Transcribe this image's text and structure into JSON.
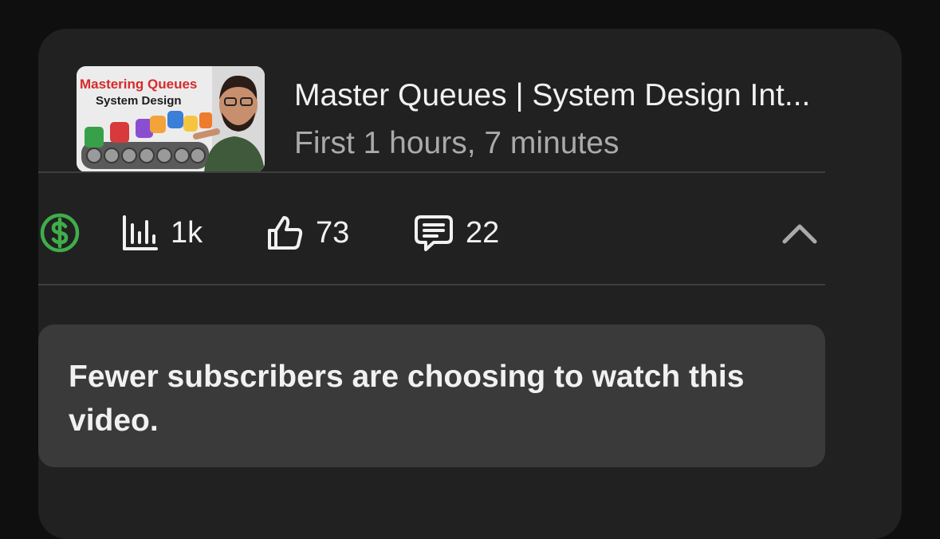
{
  "video": {
    "thumbnail": {
      "title_line1": "Mastering Queues",
      "title_line2": "System Design"
    },
    "title": "Master Queues | System Design Int...",
    "subtitle": "First 1 hours, 7 minutes"
  },
  "stats": {
    "monetization_icon": "dollar-circle-icon",
    "monetization_color": "#3fae4a",
    "views": "1k",
    "likes": "73",
    "comments": "22"
  },
  "notice": {
    "text": "Fewer subscribers are choosing to watch this video."
  }
}
